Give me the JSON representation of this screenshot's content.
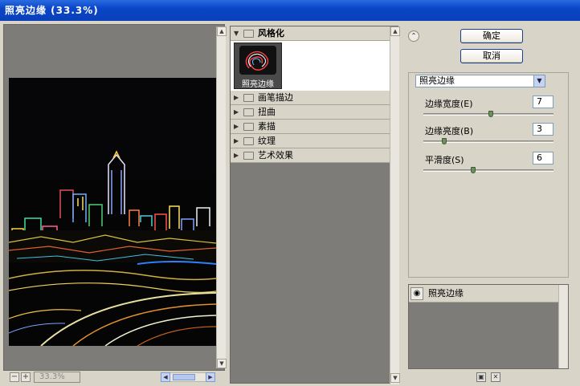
{
  "window": {
    "title": "照亮边缘 (33.3%)"
  },
  "preview": {
    "zoom_out_symbol": "−",
    "zoom_in_symbol": "+",
    "zoom_value": "33.3%"
  },
  "filter_tree": {
    "categories": [
      {
        "label": "风格化",
        "expanded": true
      },
      {
        "label": "画笔描边",
        "expanded": false
      },
      {
        "label": "扭曲",
        "expanded": false
      },
      {
        "label": "素描",
        "expanded": false
      },
      {
        "label": "纹理",
        "expanded": false
      },
      {
        "label": "艺术效果",
        "expanded": false
      }
    ],
    "selected_filter": {
      "label": "照亮边缘"
    }
  },
  "buttons": {
    "ok": "确定",
    "cancel": "取消"
  },
  "settings": {
    "filter_select": "照亮边缘",
    "params": [
      {
        "label": "边缘宽度(E)",
        "value": "7",
        "fraction": 0.52
      },
      {
        "label": "边缘亮度(B)",
        "value": "3",
        "fraction": 0.15
      },
      {
        "label": "平滑度(S)",
        "value": "6",
        "fraction": 0.38
      }
    ]
  },
  "layers": {
    "items": [
      {
        "name": "照亮边缘",
        "visible": true
      }
    ]
  },
  "colors": {
    "titlebar": "#0a46c8",
    "panel": "#d8d4c8",
    "workspace": "#7e7c79"
  }
}
